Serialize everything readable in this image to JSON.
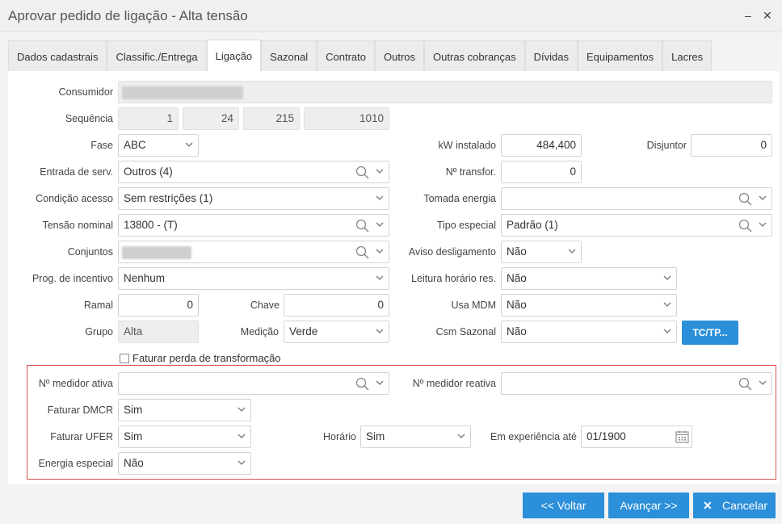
{
  "window": {
    "title": "Aprovar pedido de ligação - Alta tensão",
    "minimize": "–",
    "close": "✕"
  },
  "tabs": [
    {
      "label": "Dados cadastrais"
    },
    {
      "label": "Classific./Entrega"
    },
    {
      "label": "Ligação"
    },
    {
      "label": "Sazonal"
    },
    {
      "label": "Contrato"
    },
    {
      "label": "Outros"
    },
    {
      "label": "Outras cobranças"
    },
    {
      "label": "Dívidas"
    },
    {
      "label": "Equipamentos"
    },
    {
      "label": "Lacres"
    }
  ],
  "form": {
    "consumidor": {
      "label": "Consumidor"
    },
    "sequencia": {
      "label": "Sequência",
      "values": [
        "1",
        "24",
        "215",
        "1010"
      ]
    },
    "fase": {
      "label": "Fase",
      "value": "ABC"
    },
    "kw_instalado": {
      "label": "kW instalado",
      "value": "484,400"
    },
    "disjuntor": {
      "label": "Disjuntor",
      "value": "0"
    },
    "entrada_serv": {
      "label": "Entrada de serv.",
      "value": "Outros (4)"
    },
    "n_transfor": {
      "label": "Nº transfor.",
      "value": "0"
    },
    "condicao_acesso": {
      "label": "Condição acesso",
      "value": "Sem restrições (1)"
    },
    "tomada_energia": {
      "label": "Tomada energia",
      "value": ""
    },
    "tensao_nominal": {
      "label": "Tensão nominal",
      "value": "13800 - (T)"
    },
    "tipo_especial": {
      "label": "Tipo especial",
      "value": "Padrão (1)"
    },
    "conjuntos": {
      "label": "Conjuntos"
    },
    "aviso_desligamento": {
      "label": "Aviso desligamento",
      "value": "Não"
    },
    "prog_incentivo": {
      "label": "Prog. de incentivo",
      "value": "Nenhum"
    },
    "leitura_horario": {
      "label": "Leitura horário res.",
      "value": "Não"
    },
    "ramal": {
      "label": "Ramal",
      "value": "0"
    },
    "chave": {
      "label": "Chave",
      "value": "0"
    },
    "usa_mdm": {
      "label": "Usa MDM",
      "value": "Não"
    },
    "grupo": {
      "label": "Grupo",
      "value": "Alta"
    },
    "medicao": {
      "label": "Medição",
      "value": "Verde"
    },
    "csm_sazonal": {
      "label": "Csm Sazonal",
      "value": "Não"
    },
    "tctp_button": "TC/TP...",
    "faturar_perda": {
      "label": "Faturar perda de transformação",
      "checked": false
    },
    "medidor_ativa": {
      "label": "Nº medidor ativa",
      "value": ""
    },
    "medidor_reativa": {
      "label": "Nº medidor reativa",
      "value": ""
    },
    "faturar_dmcr": {
      "label": "Faturar DMCR",
      "value": "Sim"
    },
    "faturar_ufer": {
      "label": "Faturar UFER",
      "value": "Sim"
    },
    "horario": {
      "label": "Horário",
      "value": "Sim"
    },
    "em_experiencia": {
      "label": "Em experiência até",
      "value": "01/1900"
    },
    "energia_especial": {
      "label": "Energia especial",
      "value": "Não"
    }
  },
  "footer": {
    "voltar": "<< Voltar",
    "avancar": "Avançar >>",
    "cancelar": "Cancelar",
    "cancelar_icon": "✕"
  },
  "colors": {
    "accent": "#2b8fd9",
    "highlight_border": "#d9534f"
  }
}
